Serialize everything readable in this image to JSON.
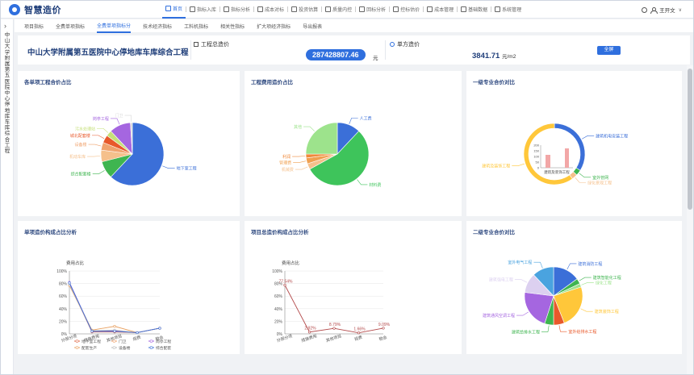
{
  "app": {
    "logo_text": "智慧造价"
  },
  "menu": [
    {
      "label": "首页",
      "active": true
    },
    {
      "label": "指标入库"
    },
    {
      "label": "指标分析"
    },
    {
      "label": "成本对标"
    },
    {
      "label": "投资估算"
    },
    {
      "label": "质量内控"
    },
    {
      "label": "回标分析"
    },
    {
      "label": "控标估价"
    },
    {
      "label": "成本管理"
    },
    {
      "label": "基础数据"
    },
    {
      "label": "系统管理"
    }
  ],
  "user": {
    "name": "王开文",
    "caret": "∨"
  },
  "sidebar": {
    "toggle": "›",
    "project_vertical": "中山大学附属第五医院中心停地库车库综合工程"
  },
  "subtabs": [
    {
      "label": "项目指标"
    },
    {
      "label": "全费单项指标"
    },
    {
      "label": "全费单项指标分",
      "active": true
    },
    {
      "label": "技术经济指标"
    },
    {
      "label": "工料机指标"
    },
    {
      "label": "相关性指标"
    },
    {
      "label": "扩大项经济指标"
    },
    {
      "label": "导出报表"
    }
  ],
  "project": {
    "title": "中山大学附属第五医院中心停地库车库综合工程",
    "total_label": "工程总造价",
    "total_value": "287428807.46",
    "total_unit": "元",
    "unit_label": "单方造价",
    "unit_value": "3841.71",
    "unit_unit": "元/m2",
    "switch_label": "全屏"
  },
  "panels": {
    "p1": {
      "title": "各单项工程合价占比"
    },
    "p2": {
      "title": "工程费用造价占比"
    },
    "p3": {
      "title": "一级专业合价对比"
    },
    "p4": {
      "title": "单项造价构成占比分析"
    },
    "p5": {
      "title": "项目总造价构成占比分析"
    },
    "p6": {
      "title": "二级专业合价对比"
    }
  },
  "chart_data": [
    {
      "type": "pie",
      "title": "各单项工程合价占比",
      "slices": [
        {
          "label": "地下室工程",
          "value": 62,
          "color": "#3b6fd8"
        },
        {
          "label": "综合配套楼",
          "value": 9,
          "color": "#3fb550"
        },
        {
          "label": "机动车库",
          "value": 6,
          "color": "#f5c08c"
        },
        {
          "label": "设备楼",
          "value": 4,
          "color": "#f0a36e"
        },
        {
          "label": "城北配套楼",
          "value": 4,
          "color": "#e8592b"
        },
        {
          "label": "污水处理站",
          "value": 3,
          "color": "#c6e07a"
        },
        {
          "label": "岗亭工程",
          "value": 11,
          "color": "#a566e0"
        },
        {
          "label": "门卫",
          "value": 1,
          "color": "#d8d8d8"
        }
      ]
    },
    {
      "type": "pie",
      "title": "工程费用造价占比",
      "slices": [
        {
          "label": "人工费",
          "value": 12,
          "color": "#3b6fd8"
        },
        {
          "label": "材料费",
          "value": 55,
          "color": "#3ec45b"
        },
        {
          "label": "机械费",
          "value": 3,
          "color": "#f5c08c"
        },
        {
          "label": "管理费",
          "value": 3,
          "color": "#f0a050"
        },
        {
          "label": "利润",
          "value": 2,
          "color": "#f08a3c"
        },
        {
          "label": "其他",
          "value": 25,
          "color": "#9de38c"
        }
      ]
    },
    {
      "type": "pie",
      "title": "一级专业合价对比",
      "slices": [
        {
          "label": "建筑机电安装工程",
          "value": 34,
          "color": "#3b6fd8"
        },
        {
          "label": "室外管网",
          "value": 3,
          "color": "#3fb550"
        },
        {
          "label": "绿化景观工程",
          "value": 3,
          "color": "#f5c08c"
        },
        {
          "label": "建筑及装饰工程",
          "value": 60,
          "color": "#ffc73a"
        }
      ],
      "inset": {
        "type": "bar",
        "yticks": [
          "200",
          "150",
          "100",
          "50",
          "0"
        ],
        "xlabel": "建筑及装饰工程"
      }
    },
    {
      "type": "line",
      "title": "单项造价构成占比分析",
      "ylabel": "费用占比",
      "yticks": [
        "100%",
        "80%",
        "60%",
        "40%",
        "20%",
        "0%"
      ],
      "categories": [
        "分部分项",
        "措施费用",
        "其他项目",
        "规费",
        "税金"
      ],
      "series": [
        {
          "name": "地下室工程",
          "values": [
            80,
            3,
            3,
            2,
            9
          ],
          "color": "#e06a4a"
        },
        {
          "name": "门卫",
          "values": [
            78,
            5,
            4,
            2,
            9
          ],
          "color": "#f0a36e"
        },
        {
          "name": "岗亭工程",
          "values": [
            82,
            4,
            5,
            2,
            9
          ],
          "color": "#a566e0"
        },
        {
          "name": "配套生产",
          "values": [
            77,
            6,
            12,
            2,
            9
          ],
          "color": "#e8a060"
        },
        {
          "name": "设备楼",
          "values": [
            79,
            5,
            6,
            2,
            9
          ],
          "color": "#bbb"
        },
        {
          "name": "综合配套",
          "values": [
            81,
            4,
            4,
            2,
            9
          ],
          "color": "#3b6fd8"
        }
      ],
      "legend_labels": [
        "地下室工程",
        "门卫",
        "岗亭工程",
        "配套生产",
        "设备楼",
        "综合配套"
      ]
    },
    {
      "type": "line",
      "title": "项目总造价构成占比分析",
      "ylabel": "费用占比",
      "yticks": [
        "100%",
        "80%",
        "60%",
        "40%",
        "20%",
        "0%"
      ],
      "categories": [
        "分部分项",
        "措施费用",
        "其他项目",
        "规费",
        "税金"
      ],
      "series": [
        {
          "name": "造价占比",
          "values": [
            77.54,
            2.92,
            8.79,
            1.66,
            9.09
          ],
          "color": "#b3494a"
        }
      ],
      "point_labels": [
        "77.54%",
        "2.92%",
        "8.79%",
        "1.66%",
        "9.09%"
      ]
    },
    {
      "type": "pie",
      "title": "二级专业合价对比",
      "slices": [
        {
          "label": "建筑消防工程",
          "value": 15,
          "color": "#3b6fd8"
        },
        {
          "label": "建筑智能化工程",
          "value": 3,
          "color": "#3fb550"
        },
        {
          "label": "绿化工程",
          "value": 2,
          "color": "#9de38c"
        },
        {
          "label": "建筑装饰工程",
          "value": 24,
          "color": "#ffc73a"
        },
        {
          "label": "室外给排水工程",
          "value": 6,
          "color": "#e8592b"
        },
        {
          "label": "建筑给排水工程",
          "value": 5,
          "color": "#3fb550"
        },
        {
          "label": "建筑通风空调工程",
          "value": 22,
          "color": "#a566e0"
        },
        {
          "label": "建筑强电工程",
          "value": 11,
          "color": "#dcd0f0"
        },
        {
          "label": "室外电气工程",
          "value": 12,
          "color": "#4aa3df"
        }
      ]
    }
  ]
}
